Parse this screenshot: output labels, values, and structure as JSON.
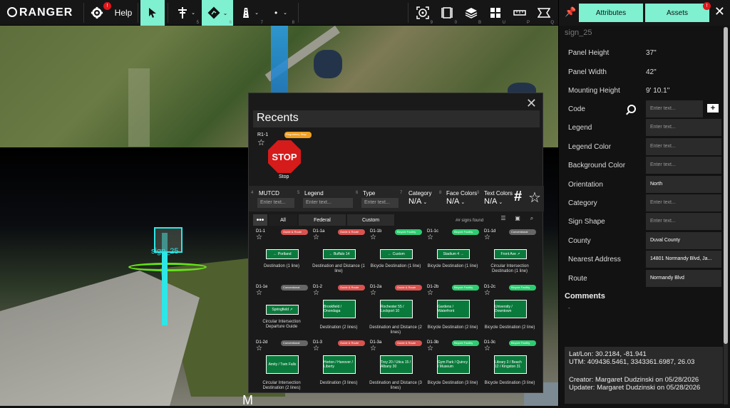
{
  "toolbar": {
    "logo": "RANGER",
    "help": "Help",
    "settings_badge": "!",
    "keys": {
      "k1": "1",
      "k2": "2",
      "k3": "3",
      "k4": "4",
      "k5": "5",
      "k6": "6",
      "k7": "7",
      "k8": "8",
      "k9": "9",
      "k0": "0",
      "kB": "B",
      "kU": "U",
      "kO": "O",
      "kP": "P",
      "kQ": "Q"
    },
    "icons": [
      "settings-icon",
      "select-cursor-icon",
      "utility-pole-icon",
      "navigation-icon",
      "road-icon",
      "point-icon",
      "snapshot-icon",
      "measure-icon",
      "layers-icon",
      "grid-icon",
      "ruler-icon",
      "view-icon"
    ]
  },
  "viewport": {
    "sign_label": "sign_25",
    "bottom_letter": "M"
  },
  "popup": {
    "title": "Recents",
    "recent": {
      "code": "R1-1",
      "tag": "Regulatory Stop",
      "sign_text": "STOP",
      "name": "Stop"
    },
    "filters": {
      "mutcd": {
        "num": "4",
        "label": "MUTCD",
        "placeholder": "Enter text..."
      },
      "legend": {
        "num": "5",
        "label": "Legend",
        "placeholder": "Enter text..."
      },
      "type": {
        "num": "6",
        "label": "Type",
        "placeholder": "Enter text..."
      },
      "category": {
        "num": "7",
        "label": "Category",
        "value": "N/A"
      },
      "face_colors": {
        "num": "8",
        "label": "Face Colors",
        "value": "N/A"
      },
      "text_colors": {
        "num": "9",
        "label": "Text Colors",
        "value": "N/A"
      }
    },
    "tabs": {
      "dots": "•••",
      "all": "All",
      "federal": "Federal",
      "custom": "Custom"
    },
    "signs_found": "## signs found",
    "signs": [
      {
        "code": "D1-1",
        "tag": "Guide & Route",
        "tag_color": "#d9534f",
        "sign": "← Portland",
        "name": "Destination (1 line)"
      },
      {
        "code": "D1-1a",
        "tag": "Guide & Route",
        "tag_color": "#d9534f",
        "sign": "← Buffalo 14",
        "name": "Destination and Distance (1 line)"
      },
      {
        "code": "D1-1b",
        "tag": "Bicycle Facility",
        "tag_color": "#2ecc71",
        "sign": "← Custom",
        "name": "Bicycle Destination (1 line)"
      },
      {
        "code": "D1-1c",
        "tag": "Bicycle Facility",
        "tag_color": "#2ecc71",
        "sign": "Stadium 4 →",
        "name": "Bicycle Destination (1 line)"
      },
      {
        "code": "D1-1d",
        "tag": "Conventional",
        "tag_color": "#666666",
        "sign": "Front Ave ↗",
        "name": "Circular Intersection Destination (1 line)"
      },
      {
        "code": "D1-1e",
        "tag": "Conventional",
        "tag_color": "#666666",
        "sign": "Springfield ↗",
        "name": "Circular Intersection Departure Guide"
      },
      {
        "code": "D1-2",
        "tag": "Guide & Route",
        "tag_color": "#d9534f",
        "sign": "Brookfield / Onondaga",
        "name": "Destination (2 lines)"
      },
      {
        "code": "D1-2a",
        "tag": "Guide & Route",
        "tag_color": "#d9534f",
        "sign": "Rochester 55 / Lockport 10",
        "name": "Destination and Distance (2 lines)"
      },
      {
        "code": "D1-2b",
        "tag": "Bicycle Facility",
        "tag_color": "#2ecc71",
        "sign": "Gardens / Waterfront",
        "name": "Bicycle Destination (2 line)"
      },
      {
        "code": "D1-2c",
        "tag": "Bicycle Facility",
        "tag_color": "#2ecc71",
        "sign": "University / Downtown",
        "name": "Bicycle Destination (2 line)"
      },
      {
        "code": "D1-2d",
        "tag": "Conventional",
        "tag_color": "#666666",
        "sign": "Amity / Twin Falls",
        "name": "Circular Intersection Destination (2 lines)"
      },
      {
        "code": "D1-3",
        "tag": "Guide & Route",
        "tag_color": "#d9534f",
        "sign": "Horton / Hanover / Liberty",
        "name": "Destination (3 lines)"
      },
      {
        "code": "D1-3a",
        "tag": "Guide & Route",
        "tag_color": "#d9534f",
        "sign": "Troy 20 / Utica 15 / Albany 30",
        "name": "Destination and Distance (3 lines)"
      },
      {
        "code": "D1-3b",
        "tag": "Bicycle Facility",
        "tag_color": "#2ecc71",
        "sign": "Gym Park / Quincy / Museum",
        "name": "Bicycle Destination (3 line)"
      },
      {
        "code": "D1-3c",
        "tag": "Bicycle Facility",
        "tag_color": "#2ecc71",
        "sign": "Library 3 / Beach 12 / Kingston 31",
        "name": "Bicycle Destination (3 line)"
      }
    ]
  },
  "panel": {
    "tab_attributes": "Attributes",
    "tab_assets": "Assets",
    "assets_badge": "!",
    "name": "sign_25",
    "rows": [
      {
        "label": "Panel Height",
        "value": "37\""
      },
      {
        "label": "Panel Width",
        "value": "42\""
      },
      {
        "label": "Mounting Height",
        "value": "9' 10.1\""
      }
    ],
    "fields": [
      {
        "label": "Code",
        "value": "Enter text...",
        "filled": false
      },
      {
        "label": "Legend",
        "value": "Enter text...",
        "filled": false
      },
      {
        "label": "Legend Color",
        "value": "Enter text...",
        "filled": false
      },
      {
        "label": "Background Color",
        "value": "Enter text...",
        "filled": false
      },
      {
        "label": "Orientation",
        "value": "North",
        "filled": true
      },
      {
        "label": "Category",
        "value": "Enter text...",
        "filled": false
      },
      {
        "label": "Sign Shape",
        "value": "Enter text...",
        "filled": false
      },
      {
        "label": "County",
        "value": "Duval County",
        "filled": true
      },
      {
        "label": "Nearest Address",
        "value": "14801 Normandy Blvd, Ja...",
        "filled": true
      },
      {
        "label": "Route",
        "value": "Normandy Blvd",
        "filled": true
      }
    ],
    "comments_label": "Comments",
    "comments_value": "-",
    "latlon": "Lat/Lon: 30.2184, -81.941",
    "utm": "UTM: 409436.5461, 3343361.6987, 26.03",
    "creator": "Creator: Margaret Dudzinski on 05/28/2026",
    "updater": "Updater: Margaret Dudzinski on 05/28/2026"
  },
  "colors": {
    "accent": "#7ff0d0",
    "badge": "#e0161b",
    "sign_green": "#0a7a3c",
    "stop_red": "#d61b1b"
  }
}
